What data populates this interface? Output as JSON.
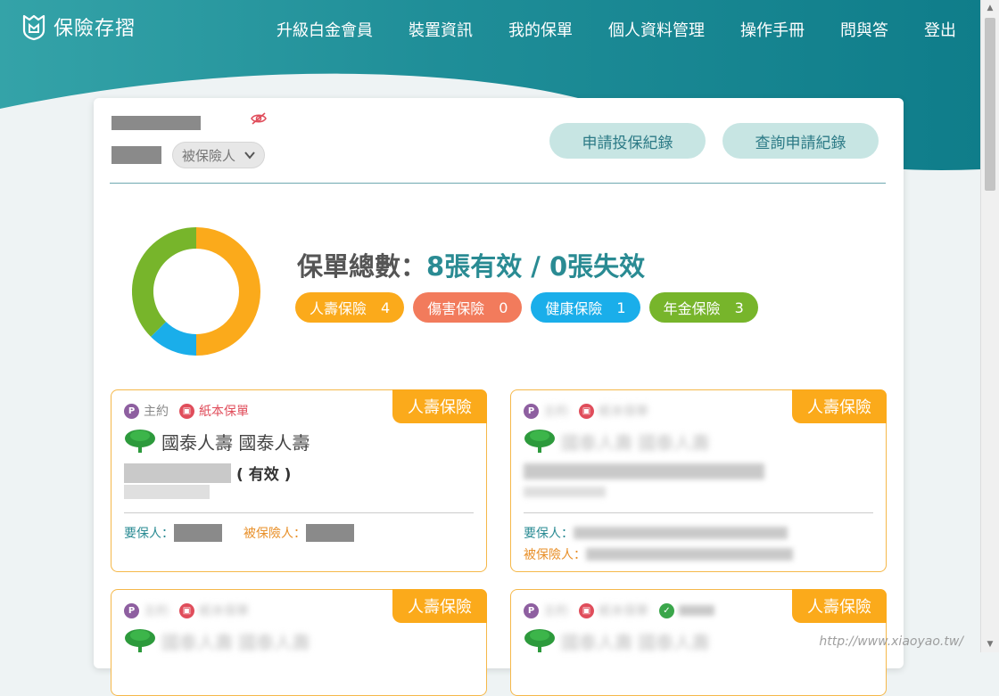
{
  "app": {
    "name": "保險存摺"
  },
  "nav": [
    "升級白金會員",
    "裝置資訊",
    "我的保單",
    "個人資料管理",
    "操作手冊",
    "問與答",
    "登出"
  ],
  "filter": {
    "role_select": "被保險人"
  },
  "actions": {
    "apply_record": "申請投保紀錄",
    "query_record": "查詢申請紀錄"
  },
  "summary": {
    "label": "保單總數：",
    "value": "8張有效 / 0張失效"
  },
  "categories": [
    {
      "label": "人壽保險",
      "count": "4",
      "color": "#fbaa1b"
    },
    {
      "label": "傷害保險",
      "count": "0",
      "color": "#f27b5c"
    },
    {
      "label": "健康保險",
      "count": "1",
      "color": "#1aaeea"
    },
    {
      "label": "年金保險",
      "count": "3",
      "color": "#77b52b"
    }
  ],
  "chart_data": {
    "type": "pie",
    "categories": [
      "人壽保險",
      "傷害保險",
      "健康保險",
      "年金保險"
    ],
    "values": [
      4,
      0,
      1,
      3
    ]
  },
  "policy_cards": [
    {
      "type_tag": "人壽保險",
      "main_label": "主約",
      "paper_label": "紙本保單",
      "company": "國泰人壽 國泰人壽",
      "status": "( 有效 )",
      "proposer_label": "要保人：",
      "insured_label": "被保險人："
    },
    {
      "type_tag": "人壽保險",
      "main_label": "主約",
      "paper_label": "紙本保單",
      "company": "國泰人壽 國泰人壽",
      "proposer_label": "要保人：",
      "insured_label": "被保險人："
    },
    {
      "type_tag": "人壽保險",
      "main_label": "主約",
      "paper_label": "紙本保單",
      "company": "國泰人壽 國泰人壽"
    },
    {
      "type_tag": "人壽保險",
      "main_label": "主約",
      "paper_label": "紙本保單",
      "company": "國泰人壽 國泰人壽"
    }
  ],
  "watermark": "http://www.xiaoyao.tw/"
}
